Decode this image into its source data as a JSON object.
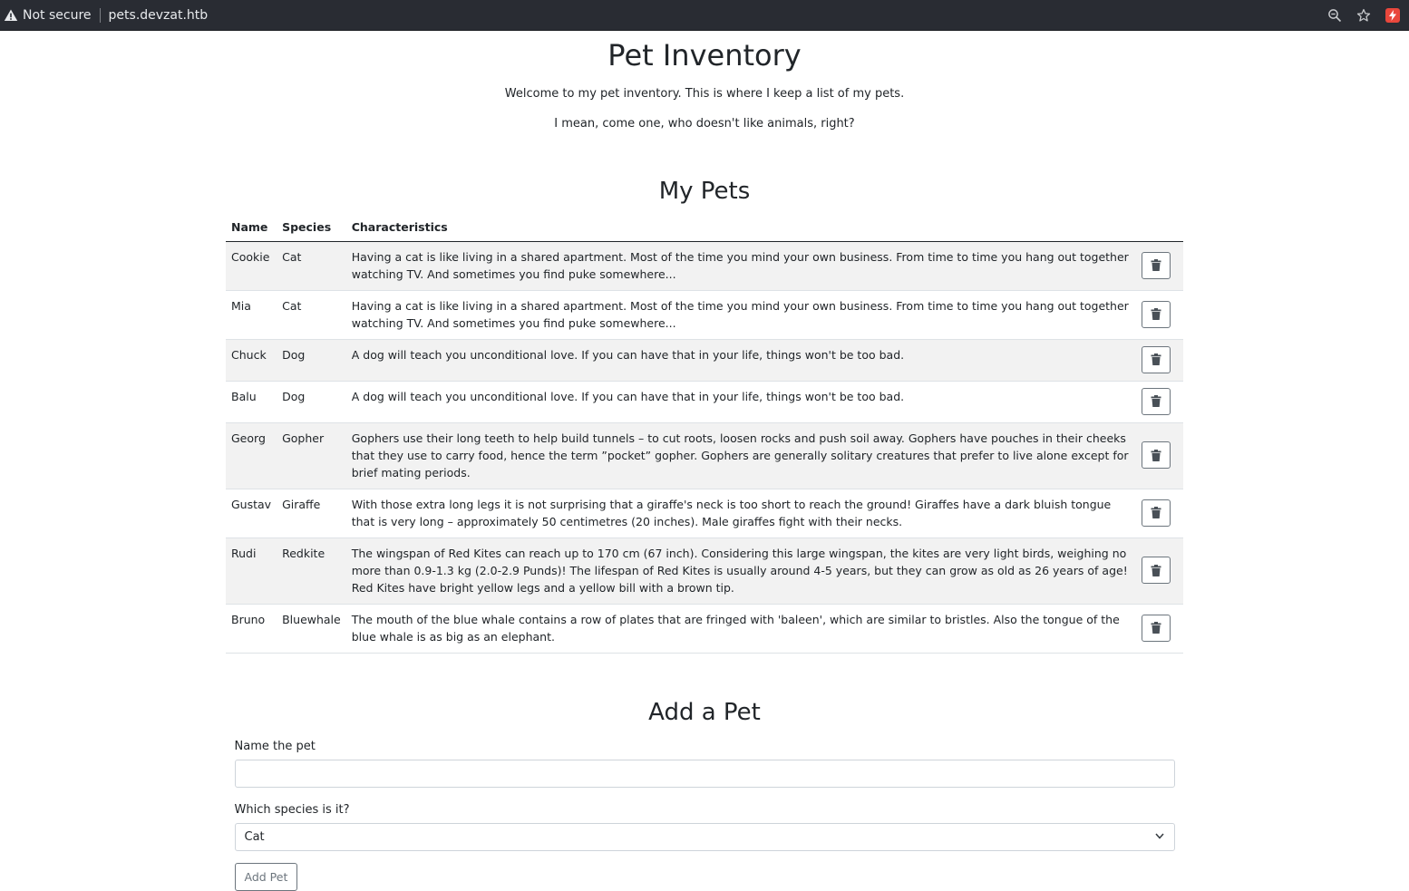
{
  "browser": {
    "security_label": "Not secure",
    "url": "pets.devzat.htb"
  },
  "page": {
    "title": "Pet Inventory",
    "intro": "Welcome to my pet inventory. This is where I keep a list of my pets.",
    "intro2": "I mean, come one, who doesn't like animals, right?"
  },
  "pets_section": {
    "heading": "My Pets",
    "columns": {
      "name": "Name",
      "species": "Species",
      "characteristics": "Characteristics"
    },
    "rows": [
      {
        "name": "Cookie",
        "species": "Cat",
        "characteristics": "Having a cat is like living in a shared apartment. Most of the time you mind your own business. From time to time you hang out together watching TV. And sometimes you find puke somewhere..."
      },
      {
        "name": "Mia",
        "species": "Cat",
        "characteristics": "Having a cat is like living in a shared apartment. Most of the time you mind your own business. From time to time you hang out together watching TV. And sometimes you find puke somewhere..."
      },
      {
        "name": "Chuck",
        "species": "Dog",
        "characteristics": "A dog will teach you unconditional love. If you can have that in your life, things won't be too bad."
      },
      {
        "name": "Balu",
        "species": "Dog",
        "characteristics": "A dog will teach you unconditional love. If you can have that in your life, things won't be too bad."
      },
      {
        "name": "Georg",
        "species": "Gopher",
        "characteristics": "Gophers use their long teeth to help build tunnels – to cut roots, loosen rocks and push soil away. Gophers have pouches in their cheeks that they use to carry food, hence the term ”pocket” gopher. Gophers are generally solitary creatures that prefer to live alone except for brief mating periods."
      },
      {
        "name": "Gustav",
        "species": "Giraffe",
        "characteristics": "With those extra long legs it is not surprising that a giraffe's neck is too short to reach the ground! Giraffes have a dark bluish tongue that is very long – approximately 50 centimetres (20 inches). Male giraffes fight with their necks."
      },
      {
        "name": "Rudi",
        "species": "Redkite",
        "characteristics": "The wingspan of Red Kites can reach up to 170 cm (67 inch). Considering this large wingspan, the kites are very light birds, weighing no more than 0.9-1.3 kg (2.0-2.9 Punds)! The lifespan of Red Kites is usually around 4-5 years, but they can grow as old as 26 years of age! Red Kites have bright yellow legs and a yellow bill with a brown tip."
      },
      {
        "name": "Bruno",
        "species": "Bluewhale",
        "characteristics": "The mouth of the blue whale contains a row of plates that are fringed with 'baleen', which are similar to bristles. Also the tongue of the blue whale is as big as an elephant."
      }
    ]
  },
  "add_section": {
    "heading": "Add a Pet",
    "name_label": "Name the pet",
    "name_value": "",
    "species_label": "Which species is it?",
    "species_selected": "Cat",
    "submit_label": "Add Pet"
  }
}
